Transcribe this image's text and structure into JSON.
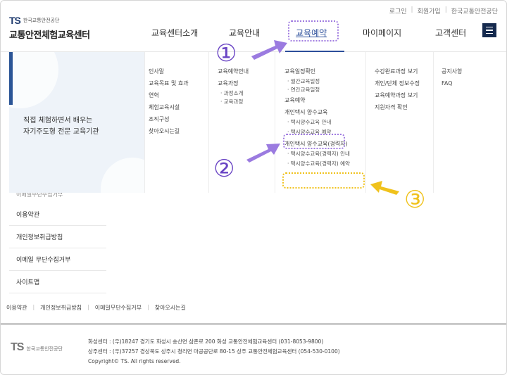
{
  "utility_links": [
    "로그인",
    "회원가입",
    "한국교통안전공단"
  ],
  "logo": {
    "mark": "TS",
    "org": "한국교통안전공단",
    "title": "교통안전체험교육센터"
  },
  "gnb": [
    "교육센터소개",
    "교육안내",
    "교육예약",
    "마이페이지",
    "고객센터"
  ],
  "visual": {
    "line1": "직접 체험하면서 배우는",
    "line2": "자기주도형 전문 교육기관"
  },
  "mega_menu": {
    "col1": [
      "인사말",
      "교육목표 및 효과",
      "연혁",
      "체험교육시설",
      "조직구성",
      "찾아오시는길"
    ],
    "col2": {
      "items": [
        "교육예약안내",
        "교육과정"
      ],
      "subs": [
        "과정소개",
        "교육과정"
      ]
    },
    "col3": {
      "a": "교육일정확인",
      "a_subs": [
        "월간교육일정",
        "연간교육일정"
      ],
      "b": "교육예약",
      "c": "개인택시 양수교육",
      "c_subs": [
        "택시양수교육 안내",
        "택시양수교육 예약"
      ],
      "d": "개인택시 양수교육(경력자)",
      "d_subs": [
        "택시양수교육(경력자) 안내",
        "택시양수교육(경력자) 예약"
      ]
    },
    "col4": [
      "수강완료과정 보기",
      "개인/단체 정보수정",
      "교육예약과정 보기",
      "지원자격 확인"
    ],
    "col5": [
      "공지사항",
      "FAQ"
    ]
  },
  "side_list": {
    "cut_text": "이메일무단수집거부",
    "items": [
      "이용약관",
      "개인정보취급방침",
      "이메일 무단수집거부",
      "사이트맵"
    ]
  },
  "footer_links": [
    "이용약관",
    "개인정보취급방침",
    "이메일무단수집거부",
    "찾아오시는길"
  ],
  "footer": {
    "logo_mark": "TS",
    "logo_org": "한국교통안전공단",
    "line1": "화성센터 : (우)18247 경기도 화성시 송산면 삼존로 200 화성 교통안전체험교육센터 (031-8053-9800)",
    "line2": "상주센터 : (우)37257 경상북도 상주시 청리면 마공공단로 80-15 상주 교통안전체험교육센터 (054-530-0100)",
    "copyright": "Copyright© TS. All rights reserved."
  },
  "annotations": {
    "n1": "①",
    "n2": "②",
    "n3": "③"
  },
  "colors": {
    "purple": "#a07ce0",
    "yellow": "#f0c21c",
    "navy": "#152a4e"
  }
}
